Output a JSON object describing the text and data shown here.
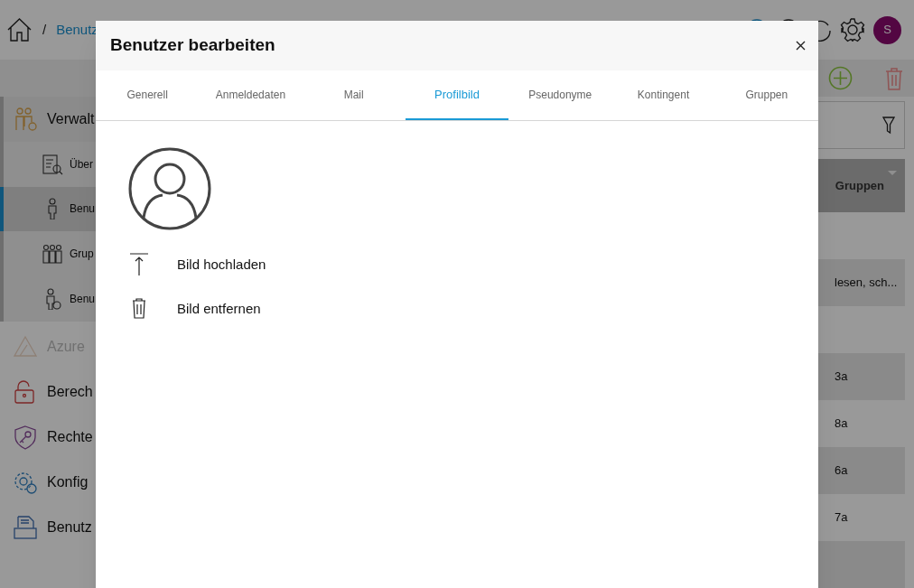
{
  "breadcrumb": {
    "separator": "/",
    "current": "Benutz"
  },
  "header": {
    "avatar": "S"
  },
  "sidebar": {
    "items": [
      {
        "label": "Verwalt",
        "kind": "group",
        "disabled": false,
        "children": [
          {
            "label": "Über",
            "selected": false
          },
          {
            "label": "Benu",
            "selected": true
          },
          {
            "label": "Grup",
            "selected": false
          },
          {
            "label": "Benu",
            "selected": false
          }
        ]
      },
      {
        "label": "Azure",
        "kind": "item",
        "disabled": true
      },
      {
        "label": "Berech",
        "kind": "item",
        "disabled": false
      },
      {
        "label": "Rechte",
        "kind": "item",
        "disabled": false
      },
      {
        "label": "Konfig",
        "kind": "item",
        "disabled": false
      },
      {
        "label": "Benutz",
        "kind": "item",
        "disabled": false
      }
    ]
  },
  "table": {
    "columns": [
      "Gruppen"
    ],
    "rows": [
      {},
      {
        "gruppen": "lesen, sch..."
      },
      {},
      {
        "gruppen": "3a"
      },
      {
        "gruppen": "8a"
      },
      {
        "gruppen": "6a"
      },
      {
        "gruppen": "7a"
      },
      {}
    ]
  },
  "dialog": {
    "title": "Benutzer bearbeiten",
    "tabs": [
      {
        "label": "Generell",
        "selected": false
      },
      {
        "label": "Anmeldedaten",
        "selected": false
      },
      {
        "label": "Mail",
        "selected": false
      },
      {
        "label": "Profilbild",
        "selected": true
      },
      {
        "label": "Pseudonyme",
        "selected": false
      },
      {
        "label": "Kontingent",
        "selected": false
      },
      {
        "label": "Gruppen",
        "selected": false
      }
    ],
    "actions": [
      {
        "label": "Bild hochladen",
        "kind": "upload"
      },
      {
        "label": "Bild entfernen",
        "kind": "remove"
      }
    ]
  }
}
